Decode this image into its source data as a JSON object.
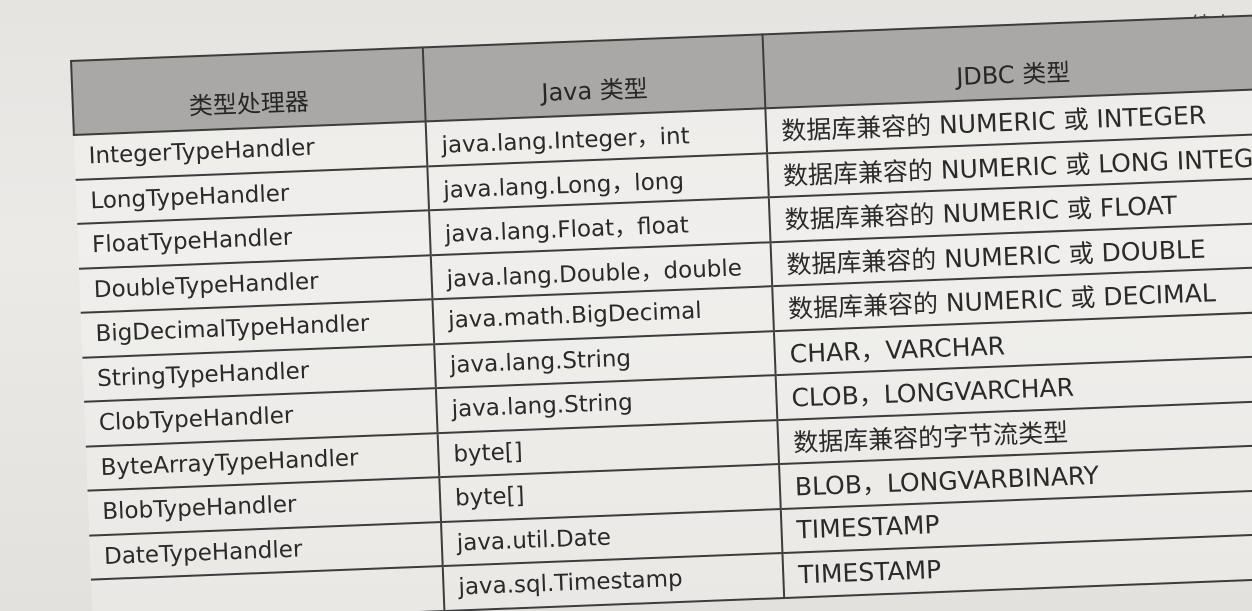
{
  "corner_note": "续表",
  "table": {
    "headers": [
      "类型处理器",
      "Java 类型",
      "JDBC 类型"
    ],
    "rows": [
      [
        "IntegerTypeHandler",
        "java.lang.Integer，int",
        "数据库兼容的 NUMERIC 或 INTEGER"
      ],
      [
        "LongTypeHandler",
        "java.lang.Long，long",
        "数据库兼容的 NUMERIC 或 LONG INTEGER"
      ],
      [
        "FloatTypeHandler",
        "java.lang.Float，float",
        "数据库兼容的 NUMERIC 或 FLOAT"
      ],
      [
        "DoubleTypeHandler",
        "java.lang.Double，double",
        "数据库兼容的 NUMERIC 或 DOUBLE"
      ],
      [
        "BigDecimalTypeHandler",
        "java.math.BigDecimal",
        "数据库兼容的 NUMERIC 或 DECIMAL"
      ],
      [
        "StringTypeHandler",
        "java.lang.String",
        "CHAR，VARCHAR"
      ],
      [
        "ClobTypeHandler",
        "java.lang.String",
        "CLOB，LONGVARCHAR"
      ],
      [
        "ByteArrayTypeHandler",
        "byte[]",
        "数据库兼容的字节流类型"
      ],
      [
        "BlobTypeHandler",
        "byte[]",
        "BLOB，LONGVARBINARY"
      ],
      [
        "DateTypeHandler",
        "java.util.Date",
        "TIMESTAMP"
      ],
      [
        "",
        "java.sql.Timestamp",
        "TIMESTAMP"
      ]
    ]
  }
}
